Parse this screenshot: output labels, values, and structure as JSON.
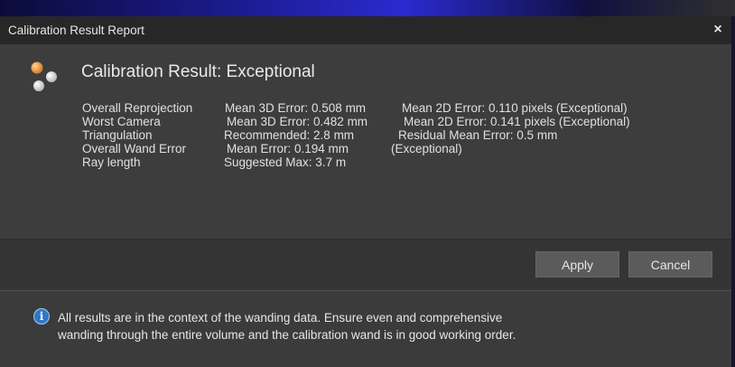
{
  "dialog": {
    "title": "Calibration Result Report",
    "close_label": "×"
  },
  "result": {
    "heading": "Calibration Result: Exceptional",
    "icon": "calibration-markers-icon"
  },
  "metrics": [
    {
      "label": "Overall Reprojection",
      "col1": "Mean 3D Error: 0.508 mm",
      "col2": "Mean 2D Error: 0.110 pixels (Exceptional)"
    },
    {
      "label": "Worst Camera",
      "col1": "Mean 3D Error: 0.482 mm",
      "col2": "Mean 2D Error: 0.141 pixels (Exceptional)"
    },
    {
      "label": "Triangulation",
      "col1": "Recommended: 2.8 mm",
      "col2": "Residual Mean Error: 0.5 mm"
    },
    {
      "label": "Overall Wand Error",
      "col1": "Mean Error: 0.194 mm",
      "col2": "(Exceptional)"
    },
    {
      "label": "Ray length",
      "col1": "Suggested Max: 3.7 m",
      "col2": ""
    }
  ],
  "buttons": {
    "apply": "Apply",
    "cancel": "Cancel"
  },
  "info": {
    "icon_glyph": "i",
    "line1": "All results are in the context of the wanding data.  Ensure even and comprehensive",
    "line2": "wanding through the entire volume and the calibration wand is in good working order."
  },
  "colors": {
    "titlebar": "#272727",
    "panel": "#3d3d3d",
    "button": "#5b5b5b",
    "info_icon": "#2e78c7",
    "marker_orange": "#e89a3c"
  }
}
